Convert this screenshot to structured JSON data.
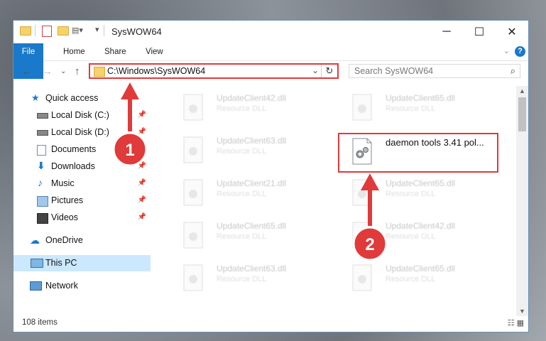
{
  "window": {
    "title": "SysWOW64"
  },
  "ribbon": {
    "tabs": [
      "File",
      "Home",
      "Share",
      "View"
    ],
    "help": "?"
  },
  "address": {
    "path": "C:\\Windows\\SysWOW64"
  },
  "search": {
    "placeholder": "Search SysWOW64"
  },
  "nav": {
    "items": [
      {
        "label": "Quick access",
        "icon": "star-icon",
        "pinned": false
      },
      {
        "label": "Local Disk (C:)",
        "icon": "drive-icon",
        "pinned": true
      },
      {
        "label": "Local Disk (D:)",
        "icon": "drive-icon",
        "pinned": true
      },
      {
        "label": "Documents",
        "icon": "documents-icon",
        "pinned": true
      },
      {
        "label": "Downloads",
        "icon": "download-icon",
        "pinned": true
      },
      {
        "label": "Music",
        "icon": "music-icon",
        "pinned": true
      },
      {
        "label": "Pictures",
        "icon": "pictures-icon",
        "pinned": true
      },
      {
        "label": "Videos",
        "icon": "videos-icon",
        "pinned": true
      },
      {
        "label": "OneDrive",
        "icon": "cloud-icon",
        "pinned": false
      },
      {
        "label": "This PC",
        "icon": "pc-icon",
        "pinned": false
      },
      {
        "label": "Network",
        "icon": "network-icon",
        "pinned": false
      }
    ]
  },
  "files": {
    "left": [
      {
        "name": "UpdateClient42.dll",
        "type": "Resource DLL"
      },
      {
        "name": "UpdateClient63.dll",
        "type": "Resource DLL"
      },
      {
        "name": "UpdateClient21.dll",
        "type": "Resource DLL"
      },
      {
        "name": "UpdateClient65.dll",
        "type": "Resource DLL"
      },
      {
        "name": "UpdateClient63.dll",
        "type": "Resource DLL"
      }
    ],
    "right": [
      {
        "name": "UpdateClient65.dll",
        "type": "Resource DLL"
      },
      {
        "name": "daemon tools 3.41 pol...",
        "type": ""
      },
      {
        "name": "UpdateClient65.dll",
        "type": "Resource DLL"
      },
      {
        "name": "UpdateClient42.dll",
        "type": "Resource DLL"
      },
      {
        "name": "UpdateClient65.dll",
        "type": "Resource DLL"
      }
    ]
  },
  "status": {
    "count": "108 items"
  },
  "annotations": {
    "step1": "1",
    "step2": "2",
    "color": "#e03a3a"
  }
}
